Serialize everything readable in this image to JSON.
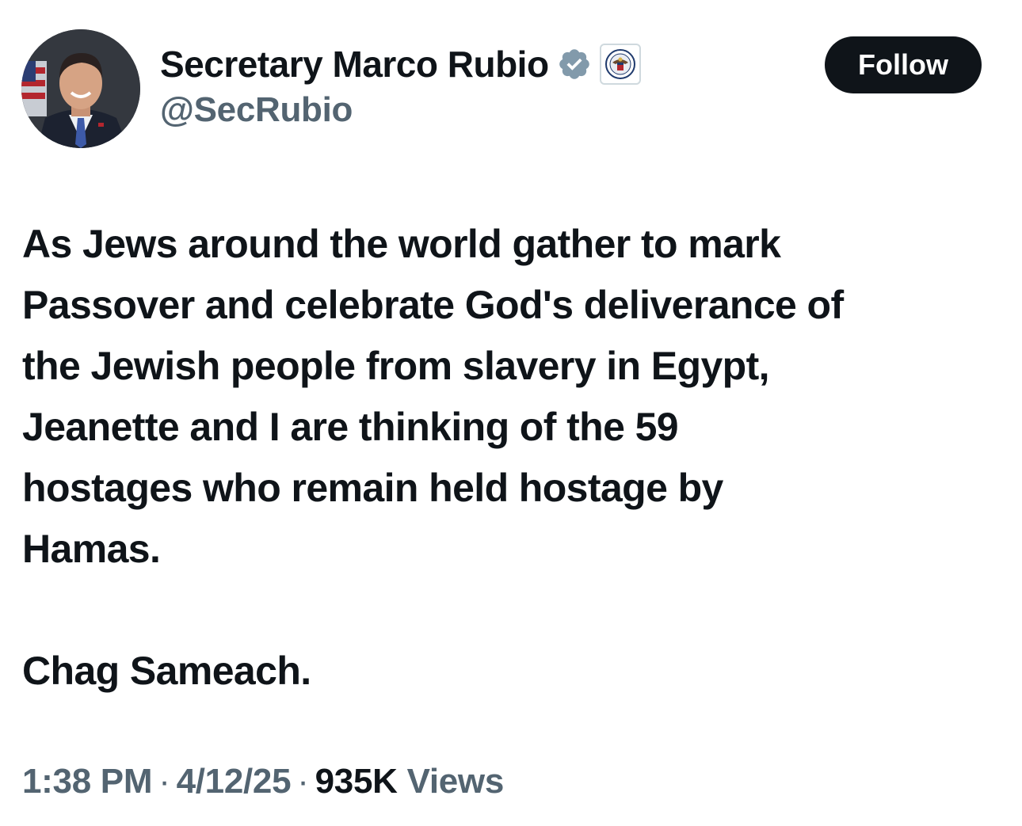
{
  "author": {
    "display_name": "Secretary Marco Rubio",
    "handle": "@SecRubio",
    "verified_icon": "verified-badge-icon",
    "affiliation_icon": "state-department-seal-icon",
    "badge_color": "#829aab"
  },
  "follow_label": "Follow",
  "tweet": {
    "lines": [
      "As Jews around the world gather to mark",
      "Passover and celebrate God's deliverance of",
      "the Jewish people from slavery in Egypt,",
      "Jeanette and I are thinking of the 59",
      "hostages who remain held hostage by",
      "Hamas."
    ],
    "closing": "Chag Sameach."
  },
  "meta": {
    "time": "1:38 PM",
    "separator": "·",
    "date": "4/12/25",
    "views_count": "935K",
    "views_label": "Views"
  }
}
